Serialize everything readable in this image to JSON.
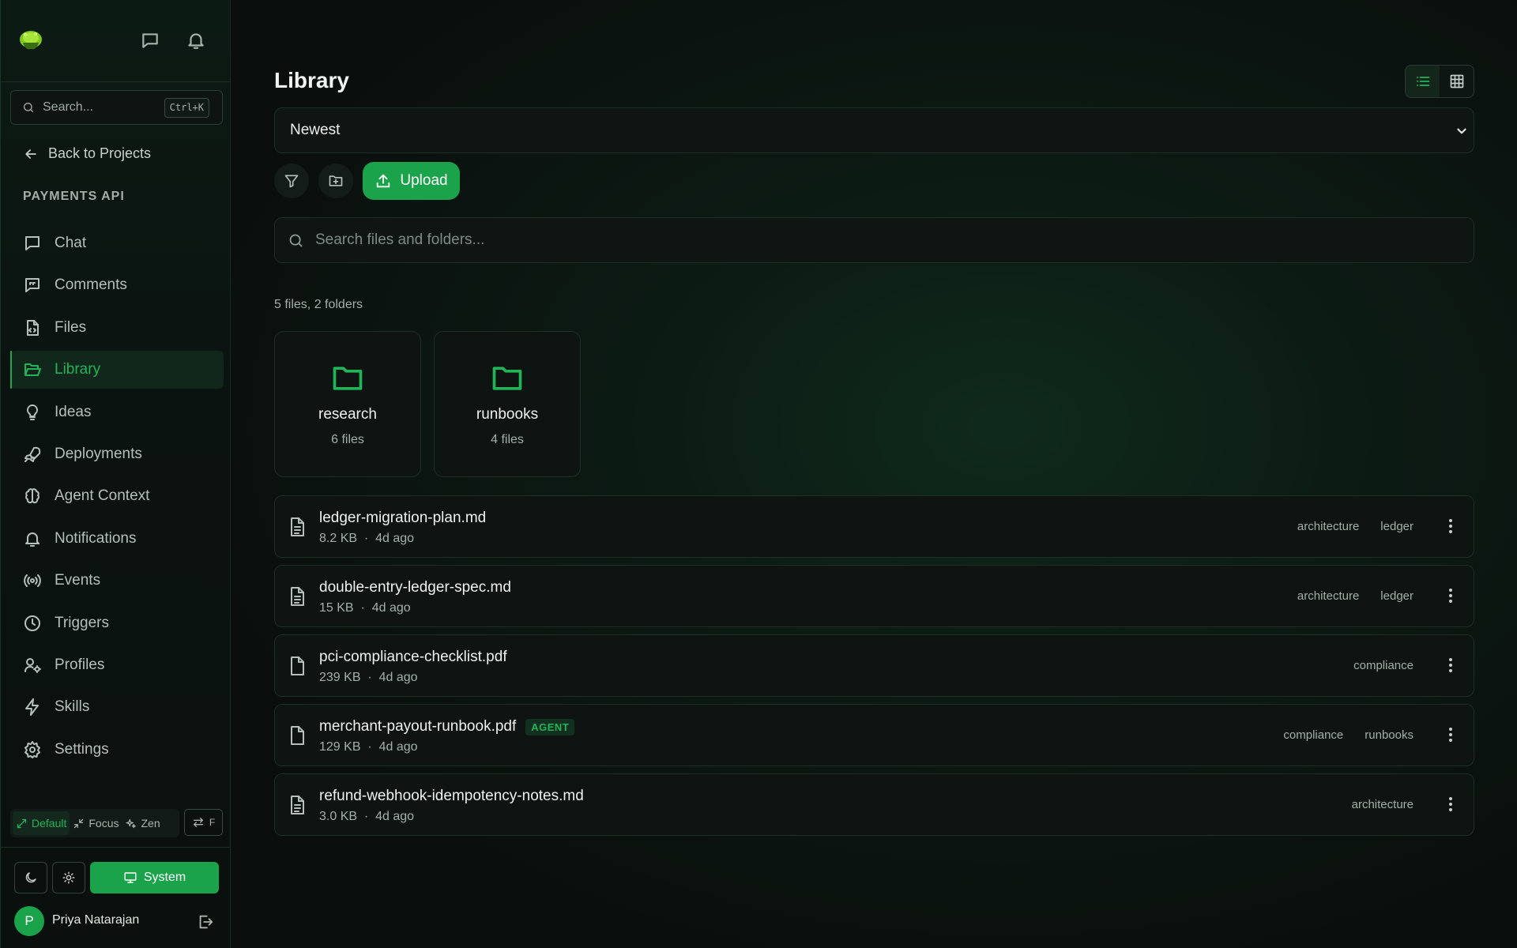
{
  "sidebar": {
    "search": {
      "placeholder": "Search...",
      "shortcut": "Ctrl+K"
    },
    "back_label": "Back to Projects",
    "project_name": "PAYMENTS API",
    "items": [
      {
        "label": "Chat",
        "icon": "chat-icon"
      },
      {
        "label": "Comments",
        "icon": "comments-icon"
      },
      {
        "label": "Files",
        "icon": "files-icon"
      },
      {
        "label": "Library",
        "icon": "folder-open-icon",
        "active": true
      },
      {
        "label": "Ideas",
        "icon": "lightbulb-icon"
      },
      {
        "label": "Deployments",
        "icon": "rocket-icon"
      },
      {
        "label": "Agent Context",
        "icon": "brain-icon"
      },
      {
        "label": "Notifications",
        "icon": "bell-icon"
      },
      {
        "label": "Events",
        "icon": "broadcast-icon"
      },
      {
        "label": "Triggers",
        "icon": "clock-icon"
      },
      {
        "label": "Profiles",
        "icon": "user-gear-icon"
      },
      {
        "label": "Skills",
        "icon": "lightning-icon"
      },
      {
        "label": "Settings",
        "icon": "gear-icon"
      }
    ],
    "modes": [
      {
        "label": "Default",
        "active": true
      },
      {
        "label": "Focus"
      },
      {
        "label": "Zen"
      }
    ],
    "swap_key": "F",
    "theme": {
      "system_label": "System"
    },
    "user": {
      "initial": "P",
      "name": "Priya Natarajan"
    }
  },
  "main": {
    "title": "Library",
    "sort": {
      "selected": "Newest"
    },
    "upload_label": "Upload",
    "search_placeholder": "Search files and folders...",
    "count_text": "5 files, 2 folders",
    "folders": [
      {
        "name": "research",
        "count": "6 files"
      },
      {
        "name": "runbooks",
        "count": "4 files"
      }
    ],
    "files": [
      {
        "name": "ledger-migration-plan.md",
        "size": "8.2 KB",
        "age": "4d ago",
        "tags": [
          "architecture",
          "ledger"
        ],
        "icon": "text-file-icon"
      },
      {
        "name": "double-entry-ledger-spec.md",
        "size": "15 KB",
        "age": "4d ago",
        "tags": [
          "architecture",
          "ledger"
        ],
        "icon": "text-file-icon"
      },
      {
        "name": "pci-compliance-checklist.pdf",
        "size": "239 KB",
        "age": "4d ago",
        "tags": [
          "compliance"
        ],
        "icon": "file-icon"
      },
      {
        "name": "merchant-payout-runbook.pdf",
        "size": "129 KB",
        "age": "4d ago",
        "tags": [
          "compliance",
          "runbooks"
        ],
        "badge": "AGENT",
        "icon": "file-icon"
      },
      {
        "name": "refund-webhook-idempotency-notes.md",
        "size": "3.0 KB",
        "age": "4d ago",
        "tags": [
          "architecture"
        ],
        "icon": "text-file-icon"
      }
    ],
    "meta_separator": "·"
  },
  "colors": {
    "accent": "#1aa34a",
    "accent_text": "#22b458",
    "background": "#0b0f0e"
  }
}
